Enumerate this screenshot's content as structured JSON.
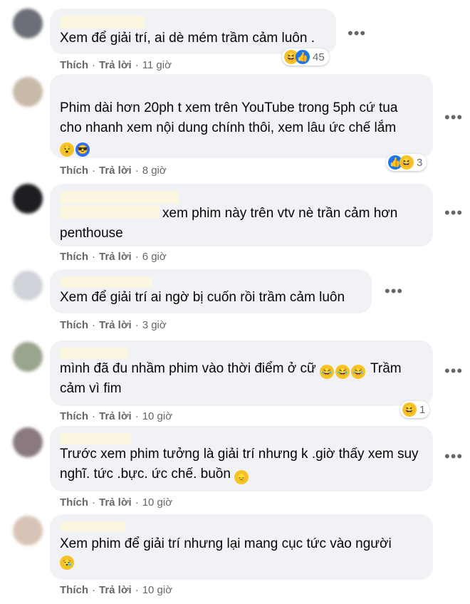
{
  "comments": [
    {
      "text": "Xem để giải trí, ai dè mém trầm cảm luôn .",
      "action1": "Thích",
      "action2": "Trả lời",
      "time": "11 giờ",
      "reactions": {
        "count": "45",
        "icons": [
          "haha-icon",
          "like-icon"
        ]
      }
    },
    {
      "text": "Phim dài hơn 20ph t xem trên YouTube trong 5ph cứ tua cho nhanh xem nội dung chính thôi, xem lâu ức chế lắm",
      "action1": "Thích",
      "action2": "Trả lời",
      "time": "8 giờ",
      "reactions": {
        "count": "3",
        "icons": [
          "like-icon",
          "haha-icon"
        ]
      }
    },
    {
      "text": "xem phim này trên vtv nè trần cảm hơn penthouse",
      "action1": "Thích",
      "action2": "Trả lời",
      "time": "6 giờ"
    },
    {
      "text": "Xem để giải trí ai ngờ bị cuốn rồi trầm cảm luôn",
      "action1": "Thích",
      "action2": "Trả lời",
      "time": "3 giờ"
    },
    {
      "text": "mình đã đu nhầm phim vào thời điểm ở cữ",
      "text_after": "Trầm cảm vì fim",
      "action1": "Thích",
      "action2": "Trả lời",
      "time": "10 giờ",
      "reactions": {
        "count": "1",
        "icons": [
          "haha-icon"
        ]
      }
    },
    {
      "text": "Trước xem phim tưởng là giải trí nhưng k .giờ thấy xem suy nghĩ. tức .bực. ức chế. buồn",
      "action1": "Thích",
      "action2": "Trả lời",
      "time": "10 giờ"
    },
    {
      "text": "Xem phim để giải trí nhưng lại mang cục tức vào người",
      "action1": "Thích",
      "action2": "Trả lời",
      "time": "10 giờ"
    }
  ],
  "more_glyph": "•••",
  "dot": "·"
}
